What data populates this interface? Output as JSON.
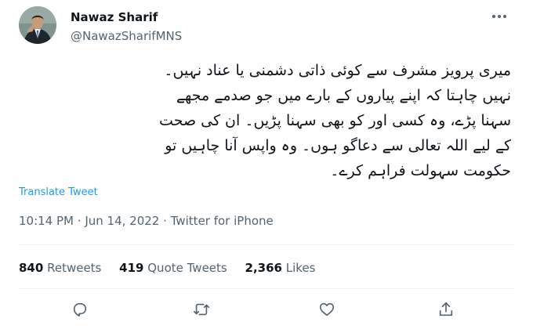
{
  "author": {
    "name": "Nawaz Sharif",
    "handle": "@NawazSharifMNS"
  },
  "tweet": {
    "text_lines": [
      "میری پرویز مشرف سے کوئی ذاتی دشمنی یا عناد نہیں۔",
      "نہیں چاہتا کہ اپنے  پیاروں کے بارے میں جو صدمے مجھے",
      "سہنا پڑے، وہ کسی اور کو بھی سہنا پڑیں۔ ان کی صحت",
      "کے لیے اللہ تعالی سے دعاگو ہوں۔ وہ واپس آنا چاہیں تو",
      "حکومت سہولت فراہم کرے۔"
    ],
    "translate_label": "Translate Tweet",
    "time": "10:14 PM",
    "date": "Jun 14, 2022",
    "source": "Twitter for iPhone",
    "separator": "·"
  },
  "stats": {
    "retweets": {
      "count": "840",
      "label": "Retweets"
    },
    "quotes": {
      "count": "419",
      "label": "Quote Tweets"
    },
    "likes": {
      "count": "2,366",
      "label": "Likes"
    }
  },
  "icons": {
    "more": "more-dots-icon",
    "reply": "reply-icon",
    "retweet": "retweet-icon",
    "like": "like-icon",
    "share": "share-icon"
  },
  "colors": {
    "text_primary": "#0f1419",
    "text_secondary": "#536471",
    "link": "#1d9bf0",
    "divider": "#eff3f4",
    "avatar_bg": "#7d8f8b"
  }
}
